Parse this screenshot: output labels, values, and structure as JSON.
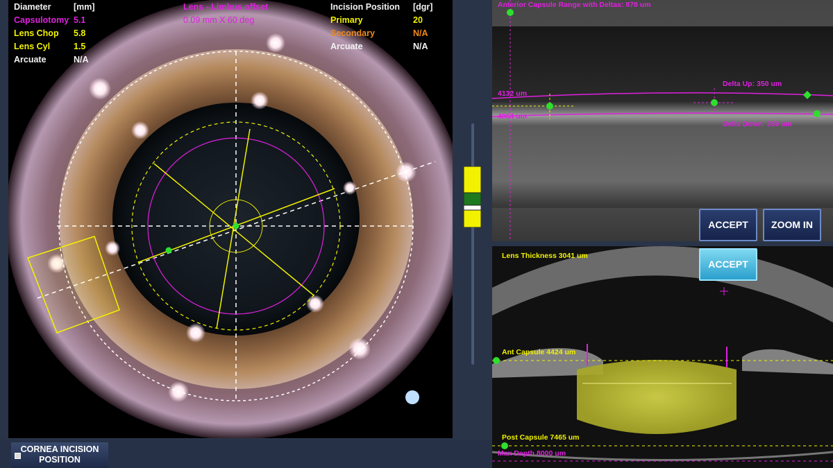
{
  "overlay": {
    "diameter_label": "Diameter",
    "diameter_unit": "[mm]",
    "capsulotomy_label": "Capsulotomy",
    "capsulotomy_value": "5.1",
    "lens_chop_label": "Lens Chop",
    "lens_chop_value": "5.8",
    "lens_cyl_label": "Lens Cyl",
    "lens_cyl_value": "1.5",
    "arcuate_label": "Arcuate",
    "arcuate_value": "N/A",
    "limbus_title": "Lens - Limbus offset",
    "limbus_value": "0.09 mm X 60 deg",
    "incision_title": "Incision Position",
    "incision_unit": "[dgr]",
    "primary_label": "Primary",
    "primary_value": "20",
    "secondary_label": "Secondary",
    "secondary_value": "N/A",
    "arcuate2_label": "Arcuate",
    "arcuate2_value": "N/A"
  },
  "oct_top": {
    "range_label": "Anterior Capsule Range with Deltas: 878 um",
    "depth_upper": "4132 um",
    "depth_lower": "4864 um",
    "delta_up": "Delta Up: 350 um",
    "delta_down": "Delta Down: 359 um",
    "accept_label": "ACCEPT",
    "zoom_label": "ZOOM IN"
  },
  "oct_bottom": {
    "lens_thickness": "Lens Thickness 3041 um",
    "ant_capsule": "Ant Capsule 4424 um",
    "post_capsule": "Post Capsule 7465 um",
    "max_depth": "Max Depth 8000 um",
    "accept_label": "ACCEPT"
  },
  "bottom": {
    "cornea_line1": "CORNEA INCISION",
    "cornea_line2": "POSITION"
  },
  "colors": {
    "magenta": "#e020e0",
    "yellow": "#f2f200",
    "orange": "#f08a1c",
    "green": "#2ee02e",
    "button": "#1e2f5a",
    "button_highlight": "#3fb0d8"
  }
}
